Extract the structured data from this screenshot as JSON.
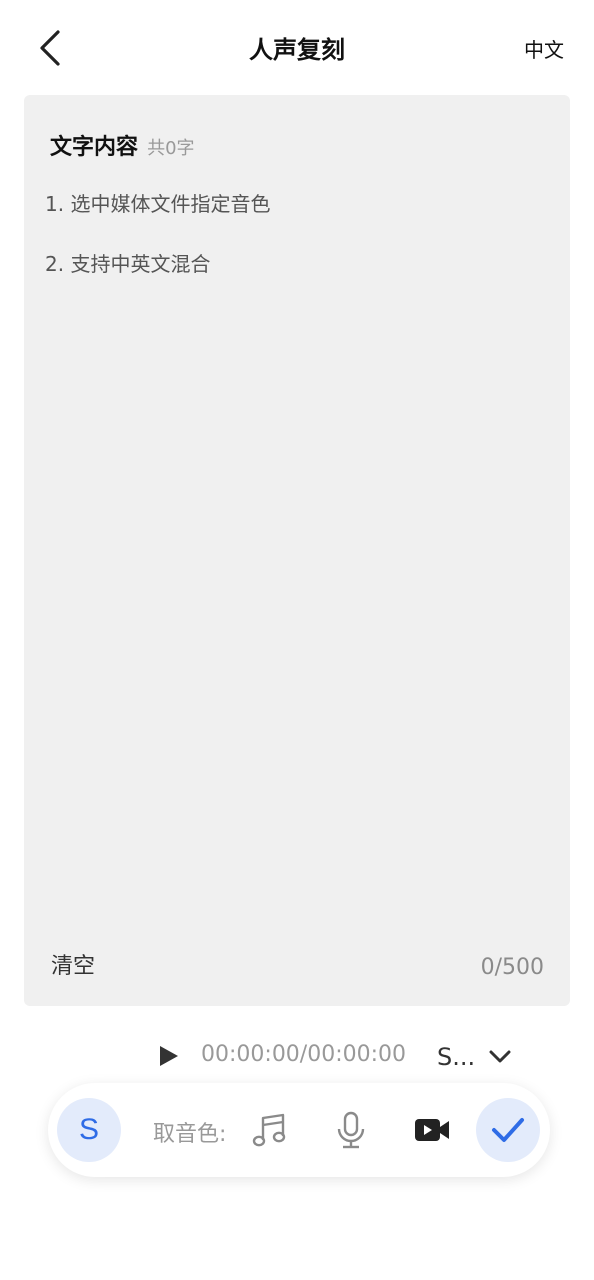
{
  "header": {
    "title": "人声复刻",
    "language": "中文"
  },
  "editor": {
    "title": "文字内容",
    "count_label": "共0字",
    "tips": [
      "1. 选中媒体文件指定音色",
      "2. 支持中英文混合"
    ],
    "clear_label": "清空",
    "char_counter": "0/500"
  },
  "player": {
    "time": "00:00:00/00:00:00",
    "speaker_label": "S..."
  },
  "toolbar": {
    "avatar_letter": "S",
    "pick_voice_label": "取音色:",
    "icons": [
      "music-icon",
      "microphone-icon",
      "video-camera-icon",
      "checkmark-icon"
    ]
  },
  "colors": {
    "accent": "#2f6ce6",
    "accent_bg": "#e3ebfb",
    "panel_bg": "#f0f0f0"
  }
}
